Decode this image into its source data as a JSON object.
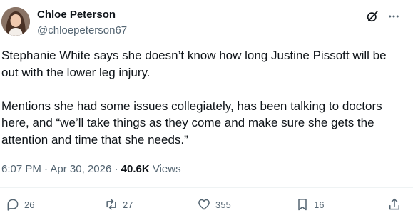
{
  "author": {
    "name": "Chloe Peterson",
    "handle": "@chloepeterson67"
  },
  "post": {
    "paragraphs": [
      "Stephanie White says she doesn’t know how long Justine Pissott will be out with the lower leg injury.",
      "Mentions she had some issues collegiately,  has been talking to doctors here, and “we’ll take things as they come and make sure she gets the attention and time that she needs.”"
    ]
  },
  "meta": {
    "time": "6:07 PM",
    "separator": "·",
    "date": "Apr 30, 2026",
    "views_count": "40.6K",
    "views_label": "Views"
  },
  "actions": {
    "replies": "26",
    "reposts": "27",
    "likes": "355",
    "bookmarks": "16"
  },
  "icons": {
    "grok": "grok-icon",
    "more": "more-icon",
    "reply": "reply-icon",
    "repost": "repost-icon",
    "like": "heart-icon",
    "bookmark": "bookmark-icon",
    "share": "share-icon"
  },
  "colors": {
    "text": "#0f1419",
    "secondary": "#536471",
    "divider": "#eff3f4"
  }
}
